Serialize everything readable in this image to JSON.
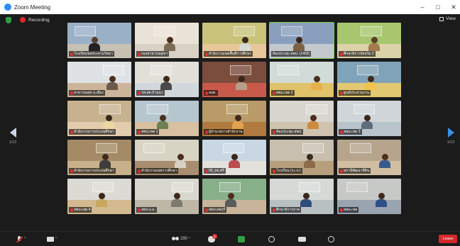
{
  "window": {
    "title": "Zoom Meeting",
    "controls": [
      "–",
      "□",
      "✕"
    ]
  },
  "status": {
    "recording_label": "Recording",
    "view_label": "View"
  },
  "nav": {
    "prev_page": "1/12",
    "next_page": "1/12"
  },
  "tiles": [
    {
      "label": "โรงเรียนชลประทานวิทยา",
      "wall": "#9ab0c7",
      "floor": "#c7c1b4",
      "person": "#5a3d2b",
      "shirt": "#222222",
      "muted": true
    },
    {
      "label": "กองสาธารณสุขฯ",
      "wall": "#e9e2d6",
      "floor": "#d9d1c4",
      "person": "#4a2e1e",
      "shirt": "#7e6b57",
      "muted": true
    },
    {
      "label": "สำนักงานเขตพื้นที่การศึกษา",
      "wall": "#c9c27a",
      "floor": "#e7c79a",
      "person": "#3e2a1c",
      "shirt": "#d8d8d8",
      "muted": true
    },
    {
      "label": "ห้องประชุม สพป. (1403)",
      "wall": "#8a9fbe",
      "floor": "#c3c8cd",
      "person": "#3a271a",
      "shirt": "#7b6244",
      "muted": false,
      "active": true
    },
    {
      "label": "ศึกษาธิการจังหวัด 2",
      "wall": "#a8c66e",
      "floor": "#dcd2a8",
      "person": "#5a3d2b",
      "shirt": "#a37b4e",
      "muted": true
    },
    {
      "label": "สาธารณสุข อ.เมือง",
      "wall": "#dfe2e5",
      "floor": "#cdb59b",
      "person": "#4a2e1e",
      "shirt": "#6b5a49",
      "muted": true
    },
    {
      "label": "รพ.สต.บ้านนา",
      "wall": "#e1dfd8",
      "floor": "#d2d7dc",
      "person": "#3e2a1c",
      "shirt": "#4a4a4a",
      "muted": true
    },
    {
      "label": "อบต.",
      "wall": "#7b4d3c",
      "floor": "#c95a4b",
      "person": "#3a271a",
      "shirt": "#b7a08a",
      "muted": true
    },
    {
      "label": "สพม.เขต 2",
      "wall": "#d1dcd8",
      "floor": "#e0c26a",
      "person": "#4a2e1e",
      "shirt": "#e6b04a",
      "muted": true
    },
    {
      "label": "ศูนย์ประสานงาน",
      "wall": "#7fa3b8",
      "floor": "#e3c872",
      "person": "#3e2a1c",
      "shirt": "#f1c34c",
      "muted": true
    },
    {
      "label": "สำนักงานการประถมศึกษา",
      "wall": "#c7b290",
      "floor": "#e3ccae",
      "person": "#3a271a",
      "shirt": "#ecd7a3",
      "muted": true
    },
    {
      "label": "สพป.เขต 1",
      "wall": "#b5c6cf",
      "floor": "#d8c0a0",
      "person": "#4a2e1e",
      "shirt": "#6e7f53",
      "muted": true
    },
    {
      "label": "ผู้อำนวยการสำนักงาน",
      "wall": "#b89b68",
      "floor": "#b07a3f",
      "person": "#3e2a1c",
      "shirt": "#e2a24c",
      "muted": true
    },
    {
      "label": "ห้องประชุม สพป.",
      "wall": "#d8d6cf",
      "floor": "#cfc3b0",
      "person": "#4a2e1e",
      "shirt": "#cd8a3c",
      "muted": true
    },
    {
      "label": "สพม.เขต 3",
      "wall": "#cfd5d8",
      "floor": "#b9c3cc",
      "person": "#3a271a",
      "shirt": "#5e6d7c",
      "muted": true
    },
    {
      "label": "สำนักงานการประถมศึกษา",
      "wall": "#a48a65",
      "floor": "#c8b08b",
      "person": "#3e2a1c",
      "shirt": "#3d3d3d",
      "muted": true
    },
    {
      "label": "สำนักงานเขตการศึกษา",
      "wall": "#d7d4c4",
      "floor": "#a88e6e",
      "person": "#4a2e1e",
      "shirt": "#d8d0c0",
      "muted": true
    },
    {
      "label": "06_ศธ.ศรี",
      "wall": "#c9d7e5",
      "floor": "#e3e1dc",
      "person": "#3a271a",
      "shirt": "#b94f4f",
      "muted": true
    },
    {
      "label": "โรงเรียน (ระ.ห.)",
      "wall": "#c8bfae",
      "floor": "#b79f7e",
      "person": "#3e2a1c",
      "shirt": "#8b6c48",
      "muted": true
    },
    {
      "label": "สถานีพัฒนาที่ดิน",
      "wall": "#b6a48d",
      "floor": "#d1bea2",
      "person": "#4a2e1e",
      "shirt": "#3a5a8a",
      "muted": true
    },
    {
      "label": "สพป.เขต 4",
      "wall": "#dcdad4",
      "floor": "#d2b98f",
      "person": "#3a271a",
      "shirt": "#c9a75c",
      "muted": true
    },
    {
      "label": "สพป.อ.ม.",
      "wall": "#d9d8d0",
      "floor": "#bfb7a6",
      "person": "#3e2a1c",
      "shirt": "#7e7a70",
      "muted": true
    },
    {
      "label": "สพป.ลพบุรี",
      "wall": "#87b08a",
      "floor": "#c7b49a",
      "person": "#4a2e1e",
      "shirt": "#5a5a5a",
      "muted": true
    },
    {
      "label": "ศึกษาธิการภาค",
      "wall": "#d5dad7",
      "floor": "#b8c0c2",
      "person": "#3a271a",
      "shirt": "#2c4e7a",
      "muted": true
    },
    {
      "label": "สพม.เขต",
      "wall": "#c7c9c6",
      "floor": "#9aa3b0",
      "person": "#3e2a1c",
      "shirt": "#2f4f86",
      "muted": true
    }
  ],
  "toolbar": {
    "participants_count": "290",
    "chat_badge": "1",
    "leave_label": "Leave"
  }
}
